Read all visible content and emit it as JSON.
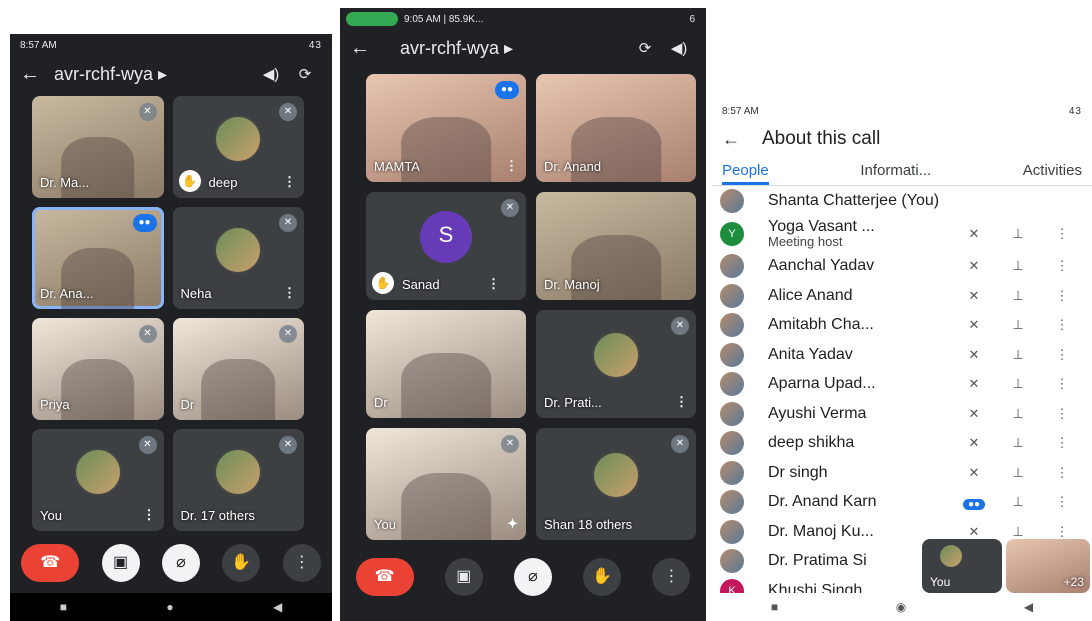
{
  "phone1": {
    "status_time": "8:57 AM",
    "status_right": "43",
    "meeting_code": "avr-rchf-wya ▸",
    "tiles": [
      {
        "label": "Dr. Ma..."
      },
      {
        "label": "deep"
      },
      {
        "label": "Dr. Ana..."
      },
      {
        "label": "Neha"
      },
      {
        "label": "Priya"
      },
      {
        "label": "Dr"
      },
      {
        "label": "You"
      },
      {
        "label": "Dr. 17 others"
      }
    ]
  },
  "phone2": {
    "status_time": "9:05 AM | 85.9K...",
    "status_right": "6",
    "meeting_code": "avr-rchf-wya ▸",
    "tiles": [
      {
        "label": "MAMTA"
      },
      {
        "label": "Dr. Anand"
      },
      {
        "label": "Sanad",
        "initial": "S"
      },
      {
        "label": "Dr. Manoj"
      },
      {
        "label": "Dr"
      },
      {
        "label": "Dr. Prati..."
      },
      {
        "label": "You"
      },
      {
        "label": "Shan 18 others"
      }
    ]
  },
  "panel": {
    "status_time": "8:57 AM",
    "status_right": "43",
    "title": "About this call",
    "tabs": [
      "People",
      "Informati...",
      "Activities"
    ],
    "people": [
      {
        "name": "Shanta Chatterjee (You)"
      },
      {
        "name": "Yoga Vasant ...",
        "sub": "Meeting host",
        "initial": "Y"
      },
      {
        "name": "Aanchal Yadav"
      },
      {
        "name": "Alice Anand"
      },
      {
        "name": "Amitabh Cha..."
      },
      {
        "name": "Anita Yadav"
      },
      {
        "name": "Aparna Upad..."
      },
      {
        "name": "Ayushi Verma"
      },
      {
        "name": "deep shikha"
      },
      {
        "name": "Dr singh"
      },
      {
        "name": "Dr. Anand Karn"
      },
      {
        "name": "Dr. Manoj Ku..."
      },
      {
        "name": "Dr. Pratima Si"
      },
      {
        "name": "Khushi Singh",
        "initial": "K"
      }
    ],
    "pip_you": "You",
    "pip_more": "+23"
  },
  "icons": {
    "back": "←",
    "mic_off": "🎙",
    "hand": "✋",
    "more": "⋮",
    "pin": "📌",
    "end_call": "☎",
    "camera_off": "📷",
    "flip": "⟳",
    "speaker": "🔊"
  }
}
